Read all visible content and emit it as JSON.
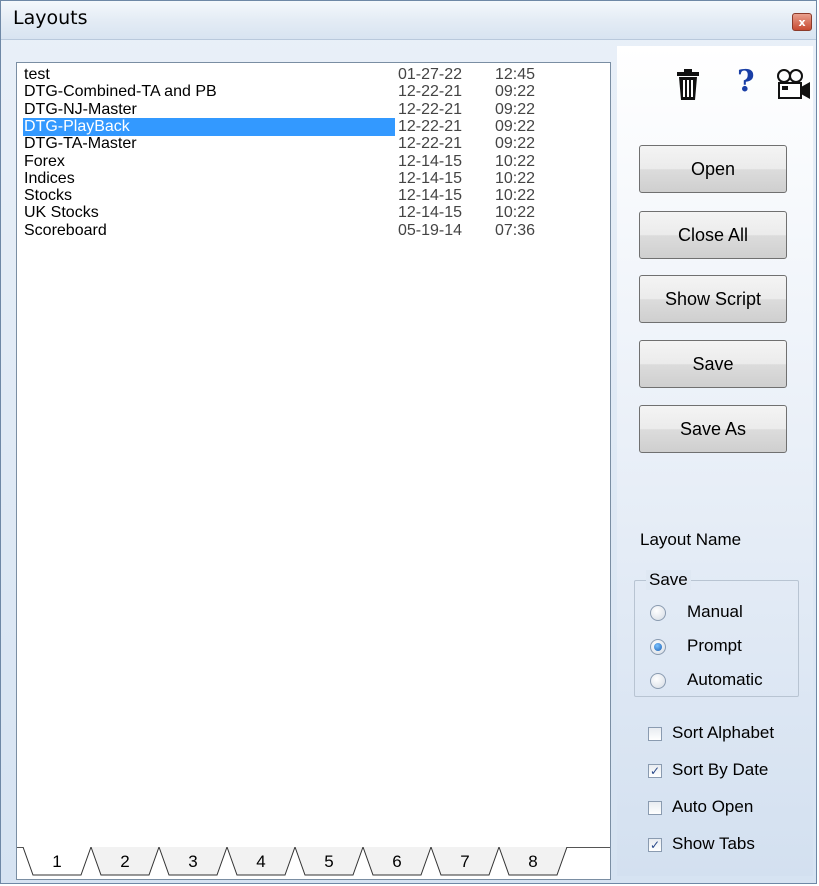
{
  "window": {
    "title": "Layouts",
    "close_label": "x"
  },
  "layouts": [
    {
      "name": "test",
      "date": "01-27-22",
      "time": "12:45",
      "selected": false
    },
    {
      "name": "DTG-Combined-TA and PB",
      "date": "12-22-21",
      "time": "09:22",
      "selected": false
    },
    {
      "name": "DTG-NJ-Master",
      "date": "12-22-21",
      "time": "09:22",
      "selected": false
    },
    {
      "name": "DTG-PlayBack",
      "date": "12-22-21",
      "time": "09:22",
      "selected": true
    },
    {
      "name": "DTG-TA-Master",
      "date": "12-22-21",
      "time": "09:22",
      "selected": false
    },
    {
      "name": "Forex",
      "date": "12-14-15",
      "time": "10:22",
      "selected": false
    },
    {
      "name": "Indices",
      "date": "12-14-15",
      "time": "10:22",
      "selected": false
    },
    {
      "name": "Stocks",
      "date": "12-14-15",
      "time": "10:22",
      "selected": false
    },
    {
      "name": "UK Stocks",
      "date": "12-14-15",
      "time": "10:22",
      "selected": false
    },
    {
      "name": "Scoreboard",
      "date": "05-19-14",
      "time": "07:36",
      "selected": false
    }
  ],
  "tabs": [
    "1",
    "2",
    "3",
    "4",
    "5",
    "6",
    "7",
    "8"
  ],
  "active_tab": "1",
  "toolbar_icons": [
    {
      "icon": "trash-icon",
      "glyph": "🗑"
    },
    {
      "icon": "help-icon",
      "glyph": "?"
    },
    {
      "icon": "video-camera-icon",
      "glyph": "🎥"
    }
  ],
  "buttons": {
    "open": "Open",
    "close_all": "Close All",
    "show_script": "Show Script",
    "save": "Save",
    "save_as": "Save As"
  },
  "layout_name_label": "Layout Name",
  "save_group": {
    "title": "Save",
    "options": [
      {
        "label": "Manual",
        "checked": false
      },
      {
        "label": "Prompt",
        "checked": true
      },
      {
        "label": "Automatic",
        "checked": false
      }
    ]
  },
  "checkboxes": [
    {
      "label": "Sort Alphabet",
      "checked": false
    },
    {
      "label": "Sort By Date",
      "checked": true
    },
    {
      "label": "Auto Open",
      "checked": false
    },
    {
      "label": "Show Tabs",
      "checked": true
    }
  ],
  "colors": {
    "selection": "#3399ff",
    "help_icon": "#1a3fa6"
  }
}
